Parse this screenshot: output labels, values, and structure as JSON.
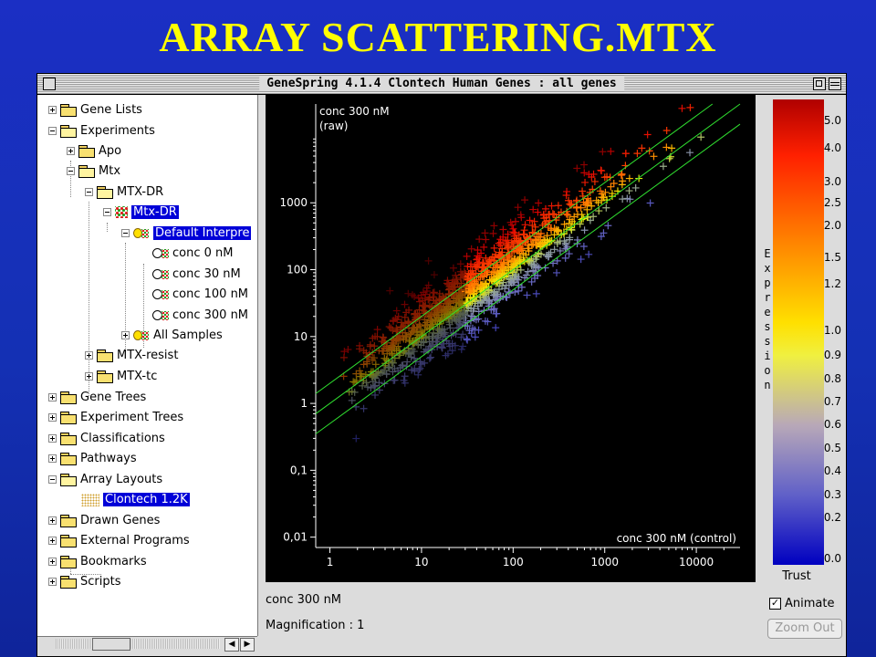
{
  "slide_title": "ARRAY SCATTERING.MTX",
  "window": {
    "title": "GeneSpring 4.1.4  Clontech Human  Genes : all genes"
  },
  "tree": {
    "gene_lists": "Gene Lists",
    "experiments": "Experiments",
    "apo": "Apo",
    "mtx": "Mtx",
    "mtx_dr": "MTX-DR",
    "mtx_dr_sel": "Mtx-DR",
    "default_interp": "Default Interpre",
    "conc0": "conc 0 nM",
    "conc30": "conc 30 nM",
    "conc100": "conc 100 nM",
    "conc300": "conc 300 nM",
    "all_samples": "All Samples",
    "mtx_resist": "MTX-resist",
    "mtx_tc": "MTX-tc",
    "gene_trees": "Gene Trees",
    "experiment_trees": "Experiment Trees",
    "classifications": "Classifications",
    "pathways": "Pathways",
    "array_layouts": "Array Layouts",
    "clontech": "Clontech 1.2K",
    "drawn_genes": "Drawn Genes",
    "external_programs": "External Programs",
    "bookmarks": "Bookmarks",
    "scripts": "Scripts"
  },
  "chart_data": {
    "type": "scatter",
    "scale": "log-log",
    "y_title_line1": "conc 300 nM",
    "y_title_line2": "(raw)",
    "xlabel": "conc 300 nM (control)",
    "x_ticks": [
      "1",
      "10",
      "100",
      "1000",
      "10000"
    ],
    "y_ticks": [
      "0,01",
      "0,1",
      "1",
      "10",
      "100",
      "1000"
    ],
    "xlim": [
      0.7,
      30000
    ],
    "ylim": [
      0.007,
      30000
    ],
    "marker": "+",
    "reference_lines": [
      {
        "fold": 2
      },
      {
        "fold": 1
      },
      {
        "fold": 0.5
      }
    ],
    "line_color": "#30e030",
    "approx_points": 1200
  },
  "legend": {
    "label": "Expression",
    "ticks": [
      "5.0",
      "4.0",
      "3.0",
      "2.5",
      "2.0",
      "1.5",
      "1.2",
      "1.0",
      "0.9",
      "0.8",
      "0.7",
      "0.6",
      "0.5",
      "0.4",
      "0.3",
      "0.2",
      "0.0"
    ],
    "trust_label": "Trust"
  },
  "status": {
    "sample_label": "conc 300 nM",
    "magnification": "Magnification : 1",
    "animate_label": "Animate",
    "animate_checked": true,
    "zoom_out_label": "Zoom Out"
  },
  "scroll_arrows": {
    "left": "◀",
    "right": "▶"
  }
}
